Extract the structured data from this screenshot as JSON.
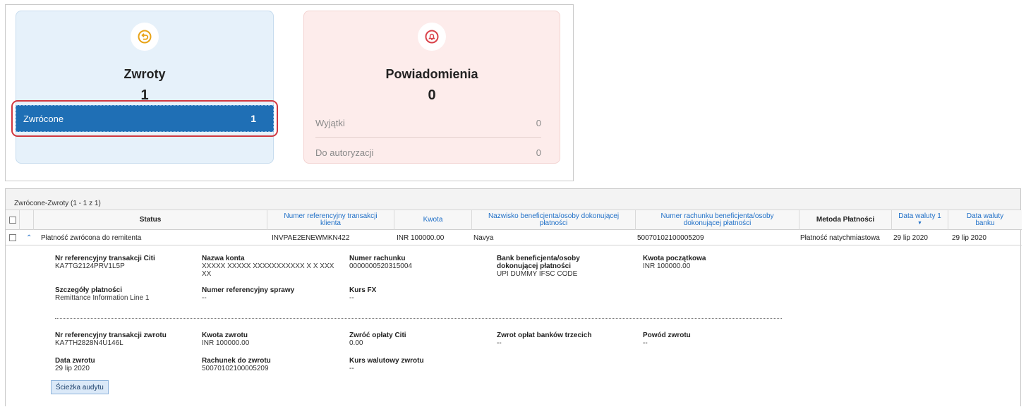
{
  "summary": {
    "returns": {
      "icon": "return-arrow-icon",
      "title": "Zwroty",
      "count": "1",
      "selected_item": {
        "label": "Zwrócone",
        "count": "1"
      }
    },
    "notifications": {
      "icon": "bell-icon",
      "title": "Powiadomienia",
      "count": "0",
      "items": [
        {
          "label": "Wyjątki",
          "count": "0"
        },
        {
          "label": "Do autoryzacji",
          "count": "0"
        }
      ]
    }
  },
  "grid": {
    "caption": "Zwrócone-Zwroty (1 - 1 z 1)",
    "headers": {
      "status": "Status",
      "ref": "Numer referencyjny transakcji klienta",
      "amount": "Kwota",
      "beneficiary": "Nazwisko beneficjenta/osoby dokonującej płatności",
      "account": "Numer rachunku beneficjenta/osoby dokonującej płatności",
      "method": "Metoda Płatności",
      "value_date": "Data waluty 1",
      "bank_date": "Data waluty banku"
    },
    "row": {
      "status": "Płatność zwrócona do remitenta",
      "ref": "INVPAE2ENEWMKN422",
      "amount": "INR 100000.00",
      "beneficiary": "Navya",
      "account": "50070102100005209",
      "method": "Płatność natychmiastowa",
      "value_date": "29 lip 2020",
      "bank_date": "29 lip 2020"
    },
    "detail": {
      "citi_ref": {
        "label": "Nr referencyjny transakcji Citi",
        "value": "KA7TG2124PRV1L5P"
      },
      "account_name": {
        "label": "Nazwa konta",
        "value": "XXXXX XXXXX XXXXXXXXXXX X X XXX XX"
      },
      "account_number": {
        "label": "Numer rachunku",
        "value": "0000000520315004"
      },
      "bank": {
        "label": "Bank beneficjenta/osoby dokonującej płatności",
        "value": "UPI DUMMY IFSC CODE"
      },
      "initial_amount": {
        "label": "Kwota początkowa",
        "value": "INR 100000.00"
      },
      "payment_details": {
        "label": "Szczegóły płatności",
        "value": "Remittance Information Line 1"
      },
      "case_ref": {
        "label": "Numer referencyjny sprawy",
        "value": "--"
      },
      "fx_rate": {
        "label": "Kurs FX",
        "value": "--"
      },
      "return_ref": {
        "label": "Nr referencyjny transakcji zwrotu",
        "value": "KA7TH2828N4U146L"
      },
      "return_amount": {
        "label": "Kwota zwrotu",
        "value": "INR 100000.00"
      },
      "citi_fees": {
        "label": "Zwróć opłaty Citi",
        "value": "0.00"
      },
      "third_party_fees": {
        "label": "Zwrot opłat banków trzecich",
        "value": "--"
      },
      "return_reason": {
        "label": "Powód zwrotu",
        "value": "--"
      },
      "return_date": {
        "label": "Data zwrotu",
        "value": "29 lip 2020"
      },
      "return_account": {
        "label": "Rachunek do zwrotu",
        "value": "50070102100005209"
      },
      "return_fx": {
        "label": "Kurs walutowy zwrotu",
        "value": "--"
      }
    },
    "audit_button": "Ścieżka audytu"
  },
  "colors": {
    "accent_blue": "#1f6fb5",
    "highlight_red": "#d0373f",
    "returns_card_bg": "#e6f1fa",
    "notifications_card_bg": "#fdeceb",
    "icon_orange": "#e8a317",
    "icon_red": "#d9424a"
  }
}
